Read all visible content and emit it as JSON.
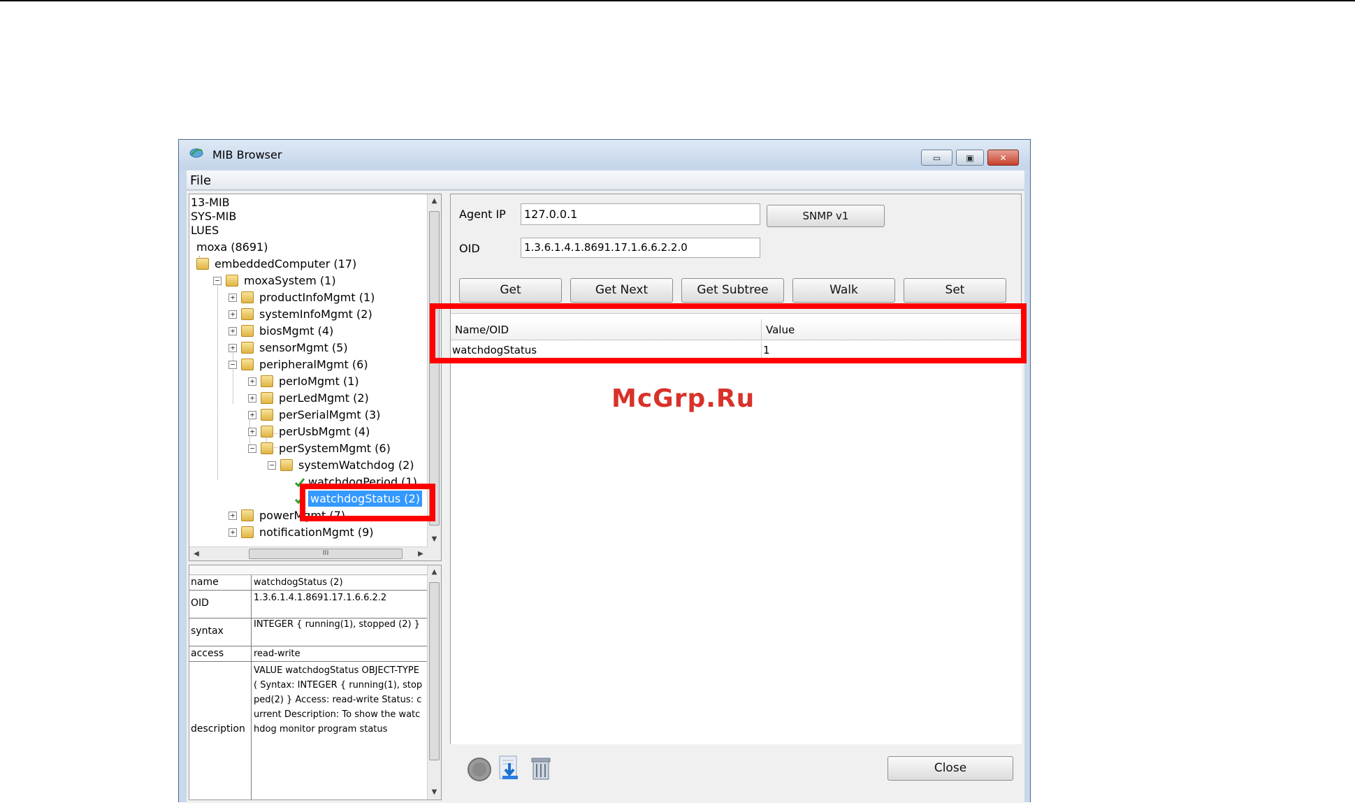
{
  "window": {
    "title": "MIB Browser",
    "controls": {
      "minimize": "▭",
      "maximize": "▣",
      "close": "✕"
    }
  },
  "menu": {
    "file": "File"
  },
  "tree": {
    "items": [
      {
        "label": "13-MIB"
      },
      {
        "label": "SYS-MIB"
      },
      {
        "label": "LUES"
      },
      {
        "label": "moxa (8691)"
      },
      {
        "label": "embeddedComputer (17)"
      },
      {
        "label": "moxaSystem (1)"
      },
      {
        "label": "productInfoMgmt (1)"
      },
      {
        "label": "systemInfoMgmt (2)"
      },
      {
        "label": "biosMgmt (4)"
      },
      {
        "label": "sensorMgmt (5)"
      },
      {
        "label": "peripheralMgmt (6)"
      },
      {
        "label": "perIoMgmt (1)"
      },
      {
        "label": "perLedMgmt (2)"
      },
      {
        "label": "perSerialMgmt (3)"
      },
      {
        "label": "perUsbMgmt (4)"
      },
      {
        "label": "perSystemMgmt (6)"
      },
      {
        "label": "systemWatchdog (2)"
      },
      {
        "label": "watchdogPeriod (1)"
      },
      {
        "label": "watchdogStatus (2)"
      },
      {
        "label": "powerMgmt (7)"
      },
      {
        "label": "notificationMgmt (9)"
      }
    ],
    "hscroll_grip": "III"
  },
  "properties": {
    "rows": [
      {
        "key": "name",
        "value": "watchdogStatus (2)"
      },
      {
        "key": "OID",
        "value": "1.3.6.1.4.1.8691.17.1.6.6.2.2"
      },
      {
        "key": "syntax",
        "value": "INTEGER { running(1), stopped (2) }"
      },
      {
        "key": "access",
        "value": "read-write"
      },
      {
        "key": "description",
        "value": "VALUE watchdogStatus OBJECT-TYPE ( Syntax: INTEGER { running(1), stopped(2) } Access: read-write Status: current Description: To show the watchdog monitor program status"
      }
    ]
  },
  "query": {
    "agent_ip_label": "Agent IP",
    "agent_ip_value": "127.0.0.1",
    "snmp_version_label": "SNMP v1",
    "oid_label": "OID",
    "oid_value": "1.3.6.1.4.1.8691.17.1.6.6.2.2.0"
  },
  "actions": {
    "get": "Get",
    "get_next": "Get Next",
    "get_subtree": "Get Subtree",
    "walk": "Walk",
    "set": "Set",
    "close": "Close"
  },
  "results": {
    "columns": [
      "Name/OID",
      "Value"
    ],
    "rows": [
      {
        "name": "watchdogStatus",
        "value": "1"
      }
    ]
  },
  "watermark": "McGrp.Ru",
  "icons": [
    "mib-browser-app-icon",
    "stop-icon",
    "save-results-icon",
    "clear-results-icon"
  ],
  "colors": {
    "highlight_box": "#ff0000",
    "selection": "#3399ff",
    "watermark": "#d8322a"
  }
}
